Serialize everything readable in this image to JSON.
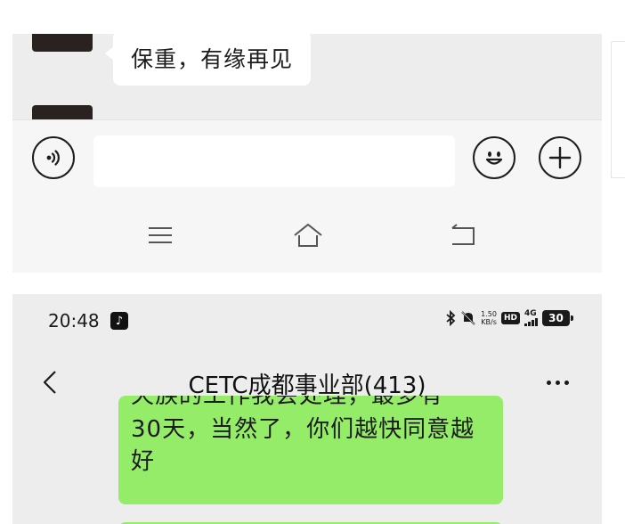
{
  "top_chat": {
    "received_message": "保重，有缘再见"
  },
  "input_bar": {
    "message_value": ""
  },
  "nav": {
    "menu_icon": "menu-icon",
    "home_icon": "home-icon",
    "back_icon": "back-icon"
  },
  "status_bar": {
    "time": "20:48",
    "net_speed_value": "1.50",
    "net_speed_unit": "KB/s",
    "hd_label": "HD",
    "network_type": "4G",
    "battery": "30"
  },
  "title_bar": {
    "title": "CETC成都事业部(413)"
  },
  "bottom_chat": {
    "sent_message_cut": "天族的工作我会处理，最多有",
    "sent_message": "30天，当然了，你们越快同意越好"
  },
  "colors": {
    "chat_background": "#ededed",
    "sent_bubble": "#95ec69",
    "received_bubble": "#ffffff",
    "avatar_blue": "#3f7fe8"
  }
}
